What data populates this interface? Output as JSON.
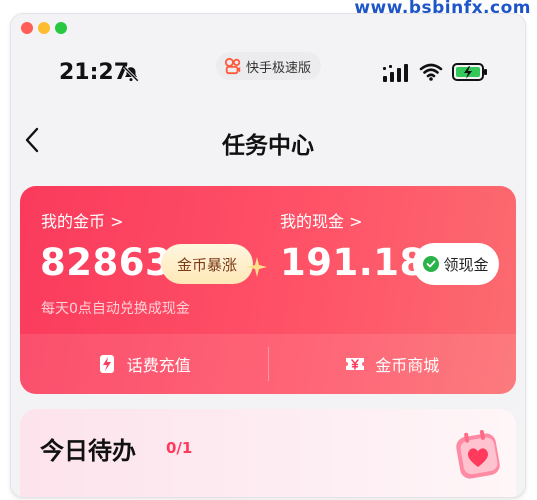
{
  "watermark": "www.bsbinfx.com",
  "status_bar": {
    "time": "21:27",
    "app_badge": "快手极速版"
  },
  "nav": {
    "title": "任务中心"
  },
  "wallet": {
    "coins_label": "我的金币 >",
    "coins_value": "82863",
    "surge_label": "金币暴涨",
    "cash_label": "我的现金 >",
    "cash_value": "191.18",
    "withdraw_label": "领现金",
    "auto_convert_note": "每天0点自动兑换成现金",
    "actions": [
      {
        "label": "话费充值",
        "icon": "phone-bolt-icon"
      },
      {
        "label": "金币商城",
        "icon": "ticket-yen-icon"
      }
    ]
  },
  "todo": {
    "title": "今日待办",
    "count": "0/1",
    "icon": "heart-calendar-icon"
  },
  "colors": {
    "card_red": "#fa3a5c",
    "accent_pink": "#ff3a5c"
  }
}
